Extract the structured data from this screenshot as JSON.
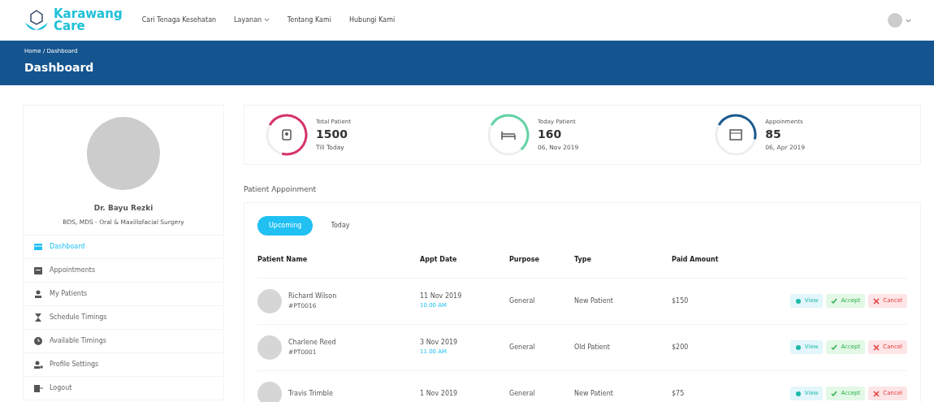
{
  "navbar": {
    "brand": [
      "Karawang",
      "Care"
    ],
    "links": [
      {
        "label": "Cari Tenaga Kesehatan",
        "dropdown": false
      },
      {
        "label": "Layanan",
        "dropdown": true
      },
      {
        "label": "Tentang Kami",
        "dropdown": false
      },
      {
        "label": "Hubungi Kami",
        "dropdown": false
      }
    ]
  },
  "header": {
    "breadcrumb": "Home / Dashboard",
    "title": "Dashboard"
  },
  "profile": {
    "name": "Dr. Bayu Rezki",
    "specialty": "BDS, MDS - Oral & Maxillofacial Surgery"
  },
  "sidebar": {
    "items": [
      {
        "label": "Dashboard",
        "selected": true
      },
      {
        "label": "Appointments",
        "selected": false
      },
      {
        "label": "My Patients",
        "selected": false
      },
      {
        "label": "Schedule Timings",
        "selected": false
      },
      {
        "label": "Available Timings",
        "selected": false
      },
      {
        "label": "Profile Settings",
        "selected": false
      },
      {
        "label": "Logout",
        "selected": false
      }
    ]
  },
  "stats": [
    {
      "label": "Total Patient",
      "value": "1500",
      "note": "Till Today",
      "color": "#d6336c"
    },
    {
      "label": "Today Patient",
      "value": "160",
      "note": "06, Nov 2019",
      "color": "#63d3a6"
    },
    {
      "label": "Appoinments",
      "value": "85",
      "note": "06, Apr 2019",
      "color": "#1b5a8e"
    }
  ],
  "appointments": {
    "title": "Patient Appoinment",
    "tabs": [
      {
        "label": "Upcoming",
        "selected": true
      },
      {
        "label": "Today",
        "selected": false
      }
    ],
    "columns": [
      "Patient Name",
      "Appt Date",
      "Purpose",
      "Type",
      "Paid Amount"
    ],
    "rows": [
      {
        "name": "Richard Wilson",
        "id": "#PT0016",
        "date": "11 Nov 2019",
        "time": "10.00 AM",
        "purpose": "General",
        "type": "New Patient",
        "amount": "$150",
        "actions": [
          "View",
          "Accept",
          "Cancel"
        ]
      },
      {
        "name": "Charlene Reed",
        "id": "#PT0001",
        "date": "3 Nov 2019",
        "time": "11.00 AM",
        "purpose": "General",
        "type": "Old Patient",
        "amount": "$200",
        "actions": [
          "View",
          "Accept",
          "Cancel"
        ]
      },
      {
        "name": "Travis Trimble",
        "date": "1 Nov 2019",
        "purpose": "General",
        "type": "New Patient",
        "amount": "$75",
        "actions": [
          "View",
          "Accept",
          "Cancel"
        ]
      }
    ]
  }
}
